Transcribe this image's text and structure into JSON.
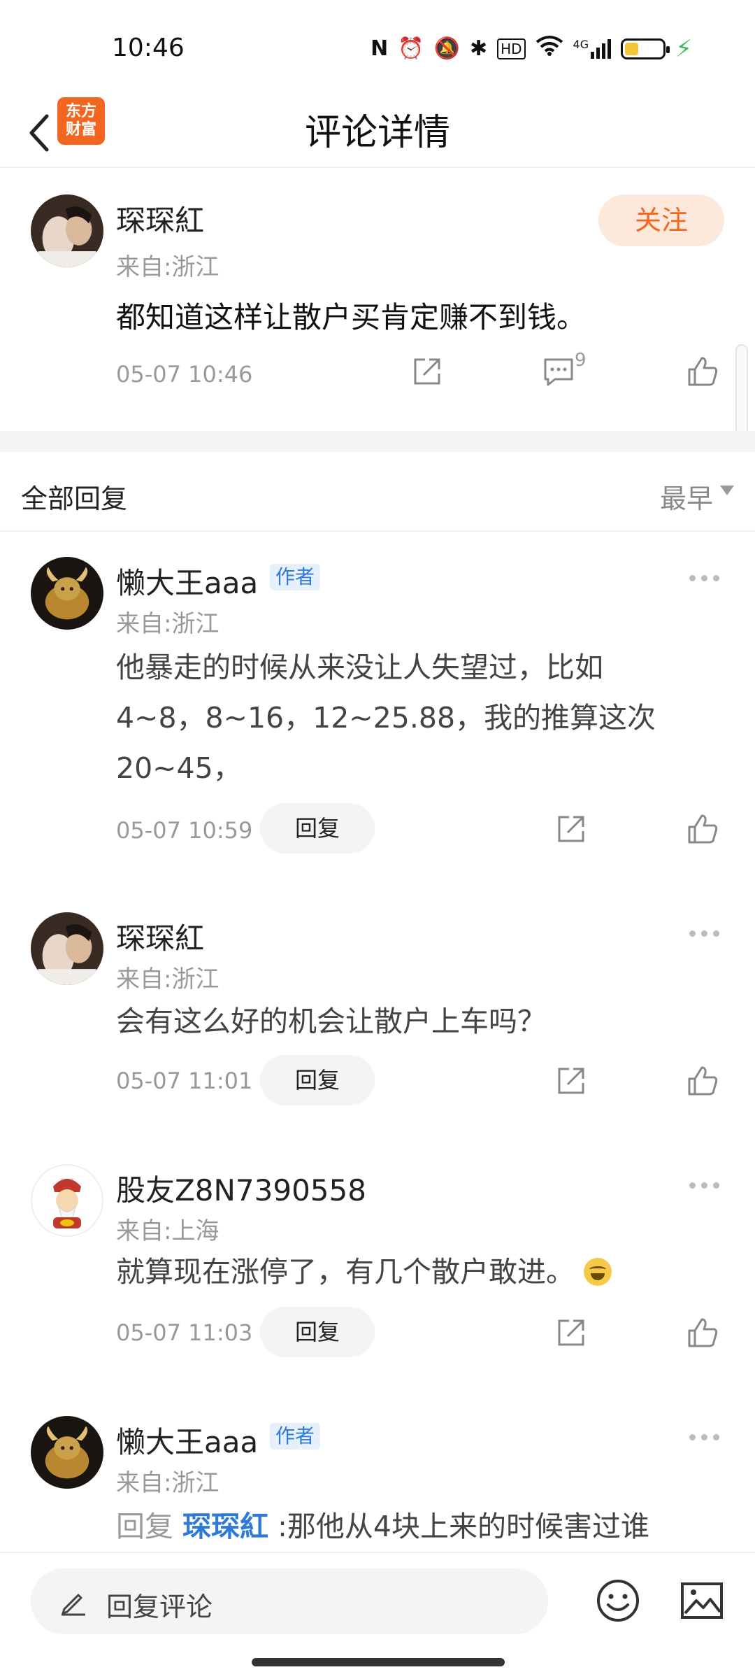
{
  "status_bar": {
    "time": "10:46",
    "icons": [
      "nfc-icon",
      "alarm-icon",
      "mute-icon",
      "bluetooth-icon",
      "hd-icon",
      "wifi-icon",
      "4g-signal-icon",
      "battery-icon",
      "charging-icon"
    ],
    "battery_level": 0.36,
    "labels": {
      "nfc": "N",
      "hd": "HD",
      "net": "4G"
    }
  },
  "header": {
    "title": "评论详情",
    "logo_text": "东方财富",
    "logo_color": "#f2661f"
  },
  "post": {
    "user": "琛琛紅",
    "location": "来自:浙江",
    "follow_label": "关注",
    "text": "都知道这样让散户买肯定赚不到钱。",
    "time": "05-07 10:46",
    "comment_count": "9"
  },
  "replies_header": {
    "label": "全部回复",
    "sort": "最早"
  },
  "comments": [
    {
      "user": "懒大王aaa",
      "tag": "作者",
      "location": "来自:浙江",
      "lines": [
        "他暴走的时候从来没让人失望过，比如",
        "4~8，8~16，12~25.88，我的推算这次",
        "20~45，"
      ],
      "time": "05-07 10:59",
      "reply_label": "回复"
    },
    {
      "user": "琛琛紅",
      "location": "来自:浙江",
      "text": "会有这么好的机会让散户上车吗？",
      "time": "05-07 11:01",
      "reply_label": "回复"
    },
    {
      "user": "股友Z8N7390558",
      "location": "来自:上海",
      "text": "就算现在涨停了，有几个散户敢进。",
      "time": "05-07 11:03",
      "reply_label": "回复"
    },
    {
      "user": "懒大王aaa",
      "tag": "作者",
      "location": "来自:浙江",
      "reply_prefix": "回复",
      "mention": "琛琛紅",
      "text": ":那他从4块上来的时候害过谁"
    }
  ],
  "bottom_bar": {
    "placeholder": "回复评论"
  },
  "colors": {
    "accent": "#f2661f",
    "link": "#2f7ad8",
    "muted": "#999999"
  }
}
